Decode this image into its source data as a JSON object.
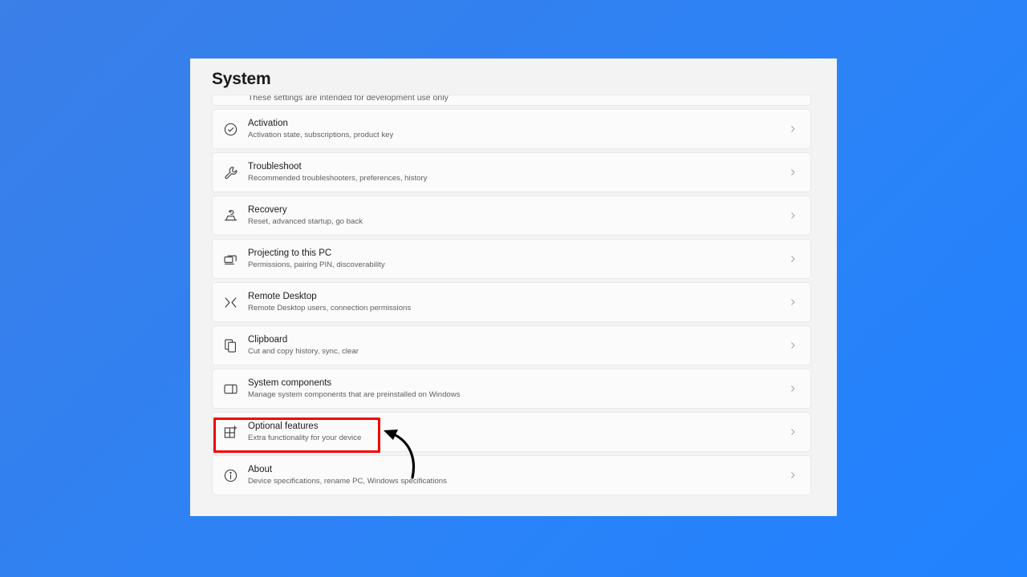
{
  "window": {
    "title": "System"
  },
  "list": {
    "partial_row": {
      "sub": "These settings are intended for development use only",
      "icon": "developer-mode-icon"
    },
    "items": [
      {
        "title": "Activation",
        "sub": "Activation state, subscriptions, product key",
        "icon": "check-circle-icon",
        "chevron": "chevron-right-icon"
      },
      {
        "title": "Troubleshoot",
        "sub": "Recommended troubleshooters, preferences, history",
        "icon": "wrench-icon",
        "chevron": "chevron-right-icon"
      },
      {
        "title": "Recovery",
        "sub": "Reset, advanced startup, go back",
        "icon": "recovery-icon",
        "chevron": "chevron-right-icon"
      },
      {
        "title": "Projecting to this PC",
        "sub": "Permissions, pairing PIN, discoverability",
        "icon": "projecting-screens-icon",
        "chevron": "chevron-right-icon"
      },
      {
        "title": "Remote Desktop",
        "sub": "Remote Desktop users, connection permissions",
        "icon": "remote-desktop-icon",
        "chevron": "chevron-right-icon"
      },
      {
        "title": "Clipboard",
        "sub": "Cut and copy history, sync, clear",
        "icon": "clipboard-icon",
        "chevron": "chevron-right-icon"
      },
      {
        "title": "System components",
        "sub": "Manage system components that are preinstalled on Windows",
        "icon": "system-components-icon",
        "chevron": "chevron-right-icon"
      },
      {
        "title": "Optional features",
        "sub": "Extra functionality for your device",
        "icon": "optional-features-grid-plus-icon",
        "chevron": "chevron-right-icon"
      },
      {
        "title": "About",
        "sub": "Device specifications, rename PC, Windows specifications",
        "icon": "info-circle-icon",
        "chevron": "chevron-right-icon"
      }
    ]
  },
  "annotations": {
    "highlight_target": "Optional features",
    "highlight_color": "#f20000",
    "arrow": "curved-arrow-pointing-left",
    "arrow_color": "#000000"
  },
  "colors": {
    "desktop_gradient_start": "#3b7fe8",
    "desktop_gradient_end": "#2182ff",
    "window_background": "#f3f3f3",
    "row_background": "#fbfbfb",
    "title_text": "#1b1b1b",
    "sub_text": "#5f5f5f"
  }
}
